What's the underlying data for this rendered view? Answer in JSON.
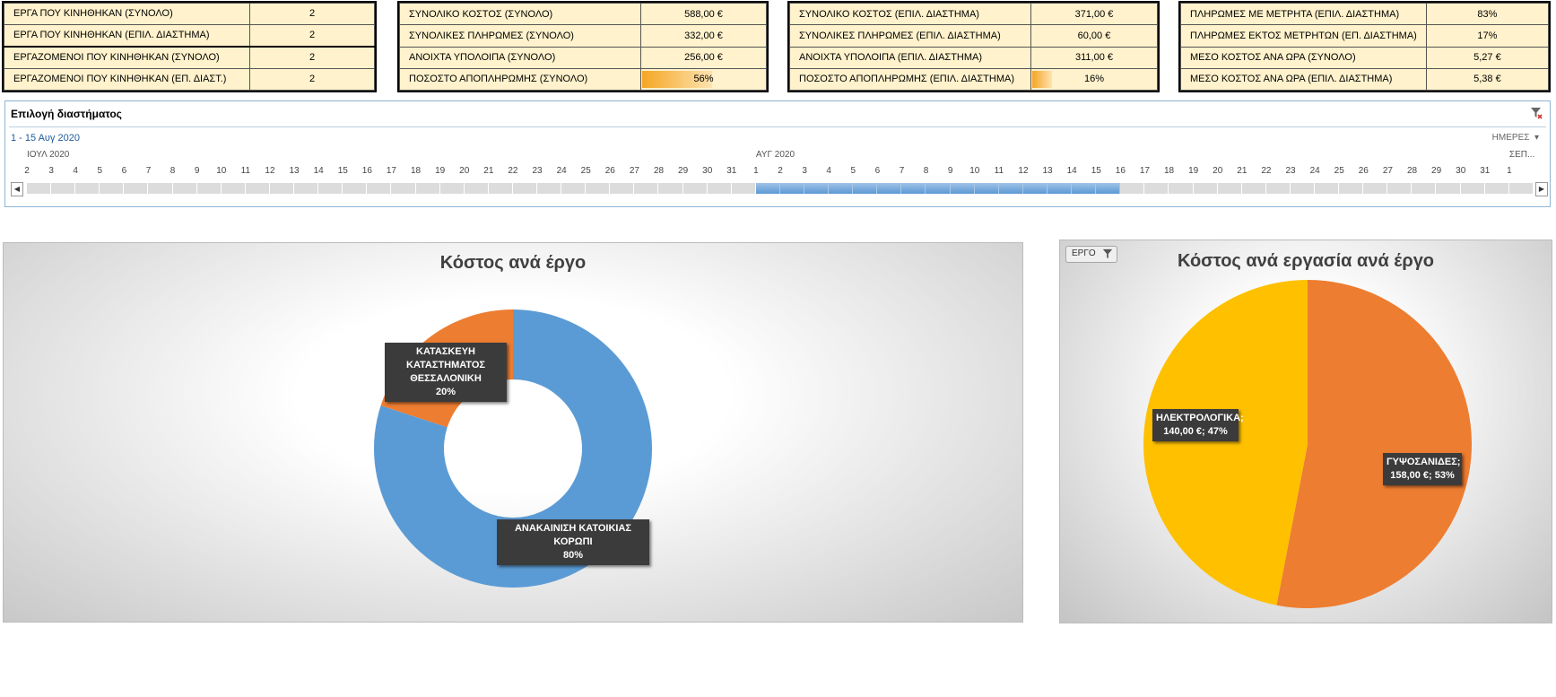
{
  "kpi_tables": [
    {
      "rows": [
        {
          "label": "ΕΡΓΑ ΠΟΥ ΚΙΝΗΘΗΚΑΝ (ΣΥΝΟΛΟ)",
          "value": "2"
        },
        {
          "label": "ΕΡΓΑ ΠΟΥ ΚΙΝΗΘΗΚΑΝ (ΕΠΙΛ. ΔΙΑΣΤΗΜΑ)",
          "value": "2"
        },
        {
          "label": "ΕΡΓΑΖΟΜΕΝΟΙ ΠΟΥ ΚΙΝΗΘΗΚΑΝ (ΣΥΝΟΛΟ)",
          "value": "2"
        },
        {
          "label": "ΕΡΓΑΖΟΜΕΝΟΙ ΠΟΥ ΚΙΝΗΘΗΚΑΝ (ΕΠ. ΔΙΑΣΤ.)",
          "value": "2"
        }
      ]
    },
    {
      "rows": [
        {
          "label": "ΣΥΝΟΛΙΚΟ ΚΟΣΤΟΣ (ΣΥΝΟΛΟ)",
          "value": "588,00 €"
        },
        {
          "label": "ΣΥΝΟΛΙΚΕΣ ΠΛΗΡΩΜΕΣ (ΣΥΝΟΛΟ)",
          "value": "332,00 €"
        },
        {
          "label": "ΑΝΟΙΧΤΑ ΥΠΟΛΟΙΠΑ (ΣΥΝΟΛΟ)",
          "value": "256,00 €"
        },
        {
          "label": "ΠΟΣΟΣΤΟ ΑΠΟΠΛΗΡΩΜΗΣ (ΣΥΝΟΛΟ)",
          "value": "56%",
          "bar": 0.56
        }
      ]
    },
    {
      "rows": [
        {
          "label": "ΣΥΝΟΛΙΚΟ ΚΟΣΤΟΣ (ΕΠΙΛ. ΔΙΑΣΤΗΜΑ)",
          "value": "371,00 €"
        },
        {
          "label": "ΣΥΝΟΛΙΚΕΣ ΠΛΗΡΩΜΕΣ (ΕΠΙΛ. ΔΙΑΣΤΗΜΑ)",
          "value": "60,00 €"
        },
        {
          "label": "ΑΝΟΙΧΤΑ ΥΠΟΛΟΙΠΑ (ΕΠΙΛ. ΔΙΑΣΤΗΜΑ)",
          "value": "311,00 €"
        },
        {
          "label": "ΠΟΣΟΣΤΟ ΑΠΟΠΛΗΡΩΜΗΣ (ΕΠΙΛ. ΔΙΑΣΤΗΜΑ)",
          "value": "16%",
          "bar": 0.16
        }
      ]
    },
    {
      "rows": [
        {
          "label": "ΠΛΗΡΩΜΕΣ ΜΕ ΜΕΤΡΗΤΑ (ΕΠΙΛ. ΔΙΑΣΤΗΜΑ)",
          "value": "83%"
        },
        {
          "label": "ΠΛΗΡΩΜΕΣ ΕΚΤΟΣ ΜΕΤΡΗΤΩΝ (ΕΠ. ΔΙΑΣΤΗΜΑ)",
          "value": "17%"
        },
        {
          "label": "ΜΕΣΟ ΚΟΣΤΟΣ ΑΝΑ ΩΡΑ (ΣΥΝΟΛΟ)",
          "value": "5,27 €"
        },
        {
          "label": "ΜΕΣΟ ΚΟΣΤΟΣ ΑΝΑ ΩΡΑ (ΕΠΙΛ. ΔΙΑΣΤΗΜΑ)",
          "value": "5,38 €"
        }
      ]
    }
  ],
  "timeline": {
    "title": "Επιλογή διαστήματος",
    "selected_range": "1 - 15 Αυγ 2020",
    "level": "ΗΜΕΡΕΣ",
    "months": [
      {
        "label": "ΙΟΥΛ 2020",
        "start_index": 0
      },
      {
        "label": "ΑΥΓ 2020",
        "start_index": 30
      },
      {
        "label": "ΣΕΠ...",
        "start_index": 61
      }
    ],
    "days": [
      "2",
      "3",
      "4",
      "5",
      "6",
      "7",
      "8",
      "9",
      "10",
      "11",
      "12",
      "13",
      "14",
      "15",
      "16",
      "17",
      "18",
      "19",
      "20",
      "21",
      "22",
      "23",
      "24",
      "25",
      "26",
      "27",
      "28",
      "29",
      "30",
      "31",
      "1",
      "2",
      "3",
      "4",
      "5",
      "6",
      "7",
      "8",
      "9",
      "10",
      "11",
      "12",
      "13",
      "14",
      "15",
      "16",
      "17",
      "18",
      "19",
      "20",
      "21",
      "22",
      "23",
      "24",
      "25",
      "26",
      "27",
      "28",
      "29",
      "30",
      "31",
      "1"
    ],
    "selected": {
      "start_index": 30,
      "end_index": 44
    }
  },
  "charts": {
    "donut": {
      "title": "Κόστος ανά έργο",
      "colors": {
        "ΑΝΑΚΑΙΝΙΣΗ ΚΑΤΟΙΚΙΑΣ ΚΟΡΩΠΙ": "#5b9bd5",
        "ΚΑΤΑΣΚΕΥΗ ΚΑΤΑΣΤΗΜΑΤΟΣ ΘΕΣΣΑΛΟΝΙΚΗ": "#ed7d31"
      },
      "label_a_line1": "ΚΑΤΑΣΚΕΥΗ ΚΑΤΑΣΤΗΜΑΤΟΣ",
      "label_a_line2": "ΘΕΣΣΑΛΟΝΙΚΗ",
      "label_a_pct": "20%",
      "label_b_line1": "ΑΝΑΚΑΙΝΙΣΗ ΚΑΤΟΙΚΙΑΣ ΚΟΡΩΠΙ",
      "label_b_pct": "80%"
    },
    "pie": {
      "title": "Κόστος ανά εργασία ανά έργο",
      "filter_label": "ΕΡΓΟ",
      "colors": {
        "ΓΥΨΟΣΑΝΙΔΕΣ": "#ed7d31",
        "ΗΛΕΚΤΡΟΛΟΓΙΚΑ": "#ffc000"
      },
      "label_a_line1": "ΗΛΕΚΤΡΟΛΟΓΙΚΑ;",
      "label_a_line2": "140,00 €; 47%",
      "label_b_line1": "ΓΥΨΟΣΑΝΙΔΕΣ;",
      "label_b_line2": "158,00 €; 53%"
    }
  },
  "chart_data": [
    {
      "type": "pie",
      "title": "Κόστος ανά έργο",
      "categories": [
        "ΑΝΑΚΑΙΝΙΣΗ ΚΑΤΟΙΚΙΑΣ ΚΟΡΩΠΙ",
        "ΚΑΤΑΣΚΕΥΗ ΚΑΤΑΣΤΗΜΑΤΟΣ ΘΕΣΣΑΛΟΝΙΚΗ"
      ],
      "values": [
        80,
        20
      ],
      "hole": true
    },
    {
      "type": "pie",
      "title": "Κόστος ανά εργασία ανά έργο",
      "categories": [
        "ΓΥΨΟΣΑΝΙΔΕΣ",
        "ΗΛΕΚΤΡΟΛΟΓΙΚΑ"
      ],
      "values": [
        158,
        140
      ]
    }
  ]
}
